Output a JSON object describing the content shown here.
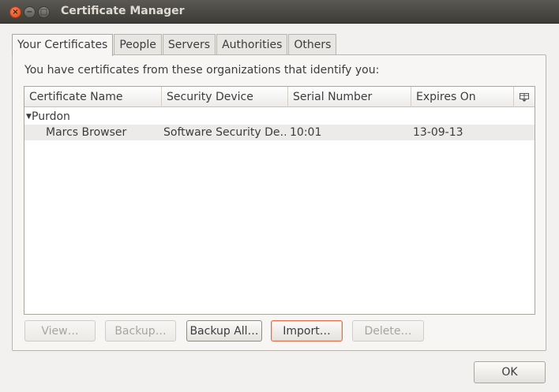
{
  "window": {
    "title": "Certificate Manager",
    "close_glyph": "×",
    "minimize_glyph": "−",
    "maximize_glyph": "□"
  },
  "tabs": [
    {
      "label": "Your Certificates",
      "active": true
    },
    {
      "label": "People",
      "active": false
    },
    {
      "label": "Servers",
      "active": false
    },
    {
      "label": "Authorities",
      "active": false
    },
    {
      "label": "Others",
      "active": false
    }
  ],
  "intro_text": "You have certificates from these organizations that identify you:",
  "table": {
    "columns": [
      "Certificate Name",
      "Security Device",
      "Serial Number",
      "Expires On"
    ],
    "column_picker_icon": "column-picker-icon",
    "groups": [
      {
        "name": "Purdon",
        "expanded": true,
        "rows": [
          {
            "name": "Marcs Browser",
            "device": "Software Security De…",
            "serial": "10:01",
            "expires": "13-09-13"
          }
        ]
      }
    ]
  },
  "buttons": {
    "view": "View…",
    "backup": "Backup…",
    "backup_all": "Backup All…",
    "import": "Import…",
    "delete": "Delete…",
    "ok": "OK"
  },
  "colors": {
    "titlebar": "#3d3c37",
    "close_button": "#df4a16",
    "focus_accent": "#e0704a"
  }
}
